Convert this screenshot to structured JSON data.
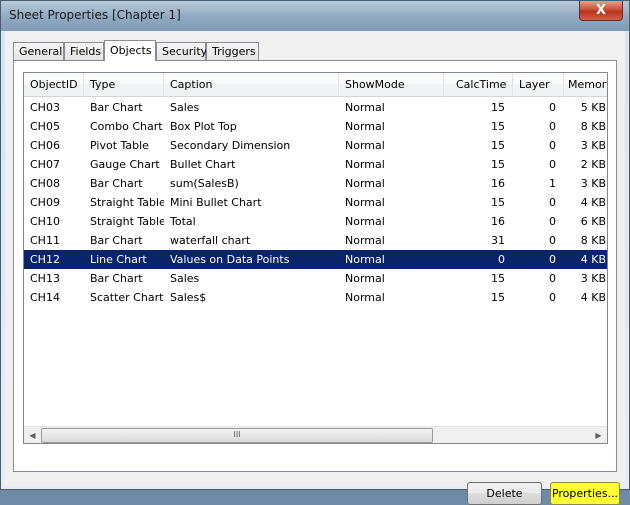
{
  "window": {
    "title": "Sheet Properties [Chapter 1]",
    "close_label": "X"
  },
  "tabs": [
    {
      "label": "General"
    },
    {
      "label": "Fields"
    },
    {
      "label": "Objects"
    },
    {
      "label": "Security"
    },
    {
      "label": "Triggers"
    }
  ],
  "active_tab": "Objects",
  "columns": [
    "ObjectID",
    "Type",
    "Caption",
    "ShowMode",
    "CalcTime",
    "Layer",
    "Memory"
  ],
  "rows": [
    {
      "id": "CH03",
      "type": "Bar Chart",
      "caption": "Sales",
      "showmode": "Normal",
      "calctime": "15",
      "layer": "0",
      "memory": "5 KB"
    },
    {
      "id": "CH05",
      "type": "Combo Chart",
      "caption": "Box Plot Top",
      "showmode": "Normal",
      "calctime": "15",
      "layer": "0",
      "memory": "8 KB"
    },
    {
      "id": "CH06",
      "type": "Pivot Table",
      "caption": "Secondary Dimension",
      "showmode": "Normal",
      "calctime": "15",
      "layer": "0",
      "memory": "3 KB"
    },
    {
      "id": "CH07",
      "type": "Gauge Chart",
      "caption": "Bullet Chart",
      "showmode": "Normal",
      "calctime": "15",
      "layer": "0",
      "memory": "2 KB"
    },
    {
      "id": "CH08",
      "type": "Bar Chart",
      "caption": "sum(SalesB)",
      "showmode": "Normal",
      "calctime": "16",
      "layer": "1",
      "memory": "3 KB"
    },
    {
      "id": "CH09",
      "type": "Straight Table",
      "caption": "Mini Bullet Chart",
      "showmode": "Normal",
      "calctime": "15",
      "layer": "0",
      "memory": "4 KB"
    },
    {
      "id": "CH10",
      "type": "Straight Table",
      "caption": "Total",
      "showmode": "Normal",
      "calctime": "16",
      "layer": "0",
      "memory": "6 KB"
    },
    {
      "id": "CH11",
      "type": "Bar Chart",
      "caption": "waterfall chart",
      "showmode": "Normal",
      "calctime": "31",
      "layer": "0",
      "memory": "8 KB"
    },
    {
      "id": "CH12",
      "type": "Line Chart",
      "caption": "Values on Data Points",
      "showmode": "Normal",
      "calctime": "0",
      "layer": "0",
      "memory": "4 KB",
      "selected": true
    },
    {
      "id": "CH13",
      "type": "Bar Chart",
      "caption": "Sales",
      "showmode": "Normal",
      "calctime": "15",
      "layer": "0",
      "memory": "3 KB"
    },
    {
      "id": "CH14",
      "type": "Scatter Chart",
      "caption": "Sales$",
      "showmode": "Normal",
      "calctime": "15",
      "layer": "0",
      "memory": "4 KB"
    }
  ],
  "scrollbar": {
    "left_arrow": "◀",
    "right_arrow": "▶",
    "thumb_grip": "III"
  },
  "buttons": {
    "delete": "Delete",
    "properties": "Properties..."
  },
  "colors": {
    "selection": "#0a246a",
    "highlight": "#ffff33"
  }
}
